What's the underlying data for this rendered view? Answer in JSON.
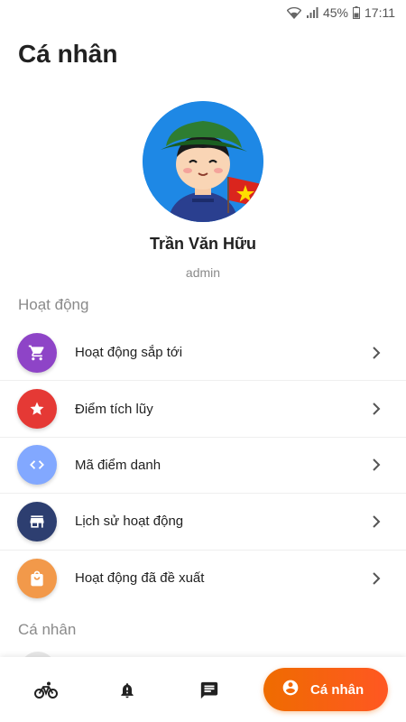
{
  "status_bar": {
    "battery": "45%",
    "time": "17:11"
  },
  "page": {
    "title": "Cá nhân"
  },
  "profile": {
    "name": "Trần Văn Hữu",
    "role": "admin"
  },
  "sections": {
    "activity": "Hoạt động",
    "personal": "Cá nhân"
  },
  "menu": [
    {
      "label": "Hoạt động sắp tới",
      "icon": "cart-icon",
      "color": "#8e44c7"
    },
    {
      "label": "Điểm tích lũy",
      "icon": "star-icon",
      "color": "#e53935"
    },
    {
      "label": "Mã điểm danh",
      "icon": "code-icon",
      "color": "#82a8ff"
    },
    {
      "label": "Lịch sử hoạt động",
      "icon": "store-icon",
      "color": "#2d3e70"
    },
    {
      "label": "Hoạt động đã đề xuất",
      "icon": "bag-icon",
      "color": "#f2994a"
    }
  ],
  "bottom_nav": {
    "items": [
      "bicycle-icon",
      "notification-alert-icon",
      "message-icon"
    ],
    "active": {
      "label": "Cá nhân",
      "icon": "account-circle-icon",
      "color": "#ef6c00"
    }
  }
}
